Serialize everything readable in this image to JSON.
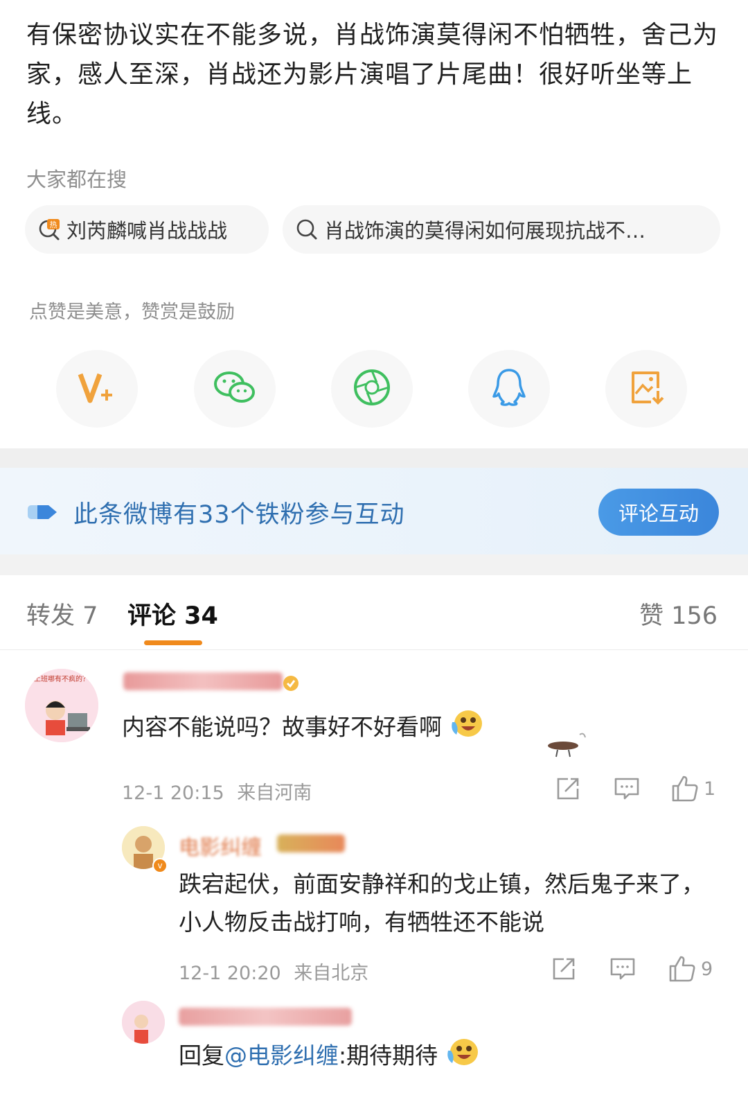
{
  "post": {
    "text": "有保密协议实在不能多说，肖战饰演莫得闲不怕牺牲，舍己为家，感人至深，肖战还为影片演唱了片尾曲！很好听坐等上线。"
  },
  "search": {
    "heading": "大家都在搜",
    "chips": [
      {
        "label": "刘芮麟喊肖战战战",
        "icon": "hot-search-icon",
        "badge": "热"
      },
      {
        "label": "肖战饰演的莫得闲如何展现抗战不…",
        "icon": "search-icon"
      }
    ]
  },
  "reward": {
    "text": "点赞是美意，赞赏是鼓励"
  },
  "share": {
    "items": [
      {
        "icon": "v-plus-icon",
        "color": "#f0a23c"
      },
      {
        "icon": "wechat-icon",
        "color": "#3fbf5f"
      },
      {
        "icon": "moments-icon",
        "color": "#3fbf5f"
      },
      {
        "icon": "qq-icon",
        "color": "#3a9ae6"
      },
      {
        "icon": "save-image-icon",
        "color": "#f0a23c"
      }
    ]
  },
  "fans": {
    "text": "此条微博有33个铁粉参与互动",
    "button": "评论互动"
  },
  "tabs": {
    "repost": "转发 7",
    "comment": "评论 34",
    "like": "赞 156"
  },
  "comments": [
    {
      "avatar_text": "上班哪有不疯的？",
      "text": "内容不能说吗？故事好不好看啊",
      "emoji": "laugh-cry-emoji",
      "time": "12-1 20:15",
      "location": "来自河南",
      "likes": "1"
    },
    {
      "name": "电影纠缠",
      "verified_badge": "v",
      "text": "跌宕起伏，前面安静祥和的戈止镇，然后鬼子来了，小人物反击战打响，有牺牲还不能说",
      "time": "12-1 20:20",
      "location": "来自北京",
      "likes": "9"
    },
    {
      "reply_prefix": "回复",
      "mention": "@电影纠缠",
      "text": ":期待期待",
      "emoji": "laugh-cry-emoji"
    }
  ],
  "colors": {
    "accent_orange": "#f08a1c",
    "link_blue": "#2f6fb0",
    "button_blue": "#4a9ae6"
  }
}
